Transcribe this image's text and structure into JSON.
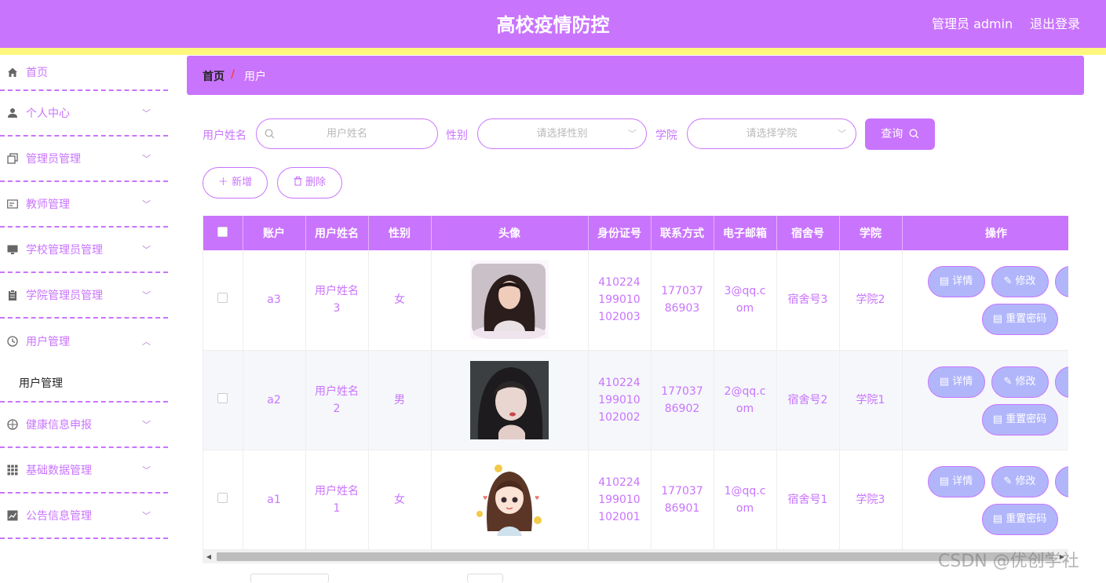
{
  "header": {
    "title": "高校疫情防控",
    "user": "管理员 admin",
    "logout": "退出登录"
  },
  "sidebar": {
    "items": [
      {
        "label": "首页",
        "icon": "home-icon"
      },
      {
        "label": "个人中心",
        "icon": "user-icon"
      },
      {
        "label": "管理员管理",
        "icon": "copy-icon"
      },
      {
        "label": "教师管理",
        "icon": "card-icon"
      },
      {
        "label": "学校管理员管理",
        "icon": "monitor-icon"
      },
      {
        "label": "学院管理员管理",
        "icon": "clipboard-icon"
      },
      {
        "label": "用户管理",
        "icon": "clock-icon"
      },
      {
        "label": "健康信息申报",
        "icon": "compass-icon"
      },
      {
        "label": "基础数据管理",
        "icon": "grid-icon"
      },
      {
        "label": "公告信息管理",
        "icon": "chart-icon"
      }
    ],
    "sub_item": "用户管理"
  },
  "breadcrumb": {
    "home": "首页",
    "sep": "/",
    "current": "用户"
  },
  "filters": {
    "name_label": "用户姓名",
    "name_placeholder": "用户姓名",
    "gender_label": "性别",
    "gender_placeholder": "请选择性别",
    "college_label": "学院",
    "college_placeholder": "请选择学院",
    "query": "查询"
  },
  "actions": {
    "add": "新增",
    "delete": "删除"
  },
  "table": {
    "columns": [
      "账户",
      "用户姓名",
      "性别",
      "头像",
      "身份证号",
      "联系方式",
      "电子邮箱",
      "宿舍号",
      "学院",
      "操作"
    ],
    "rows": [
      {
        "account": "a3",
        "name": "用户姓名3",
        "gender": "女",
        "id": "410224199010102003",
        "phone": "17703786903",
        "email": "3@qq.com",
        "dorm": "宿舍号3",
        "college": "学院2"
      },
      {
        "account": "a2",
        "name": "用户姓名2",
        "gender": "男",
        "id": "410224199010102002",
        "phone": "17703786902",
        "email": "2@qq.com",
        "dorm": "宿舍号2",
        "college": "学院1"
      },
      {
        "account": "a1",
        "name": "用户姓名1",
        "gender": "女",
        "id": "410224199010102001",
        "phone": "17703786901",
        "email": "1@qq.com",
        "dorm": "宿舍号1",
        "college": "学院3"
      }
    ],
    "ops": {
      "detail": "详情",
      "edit": "修改",
      "reset": "重置密码"
    }
  },
  "watermark": "CSDN @优创学社",
  "colors": {
    "primary": "#c974fd",
    "accent_yellow": "#fdf77e",
    "op_button": "#b1b6fb"
  }
}
